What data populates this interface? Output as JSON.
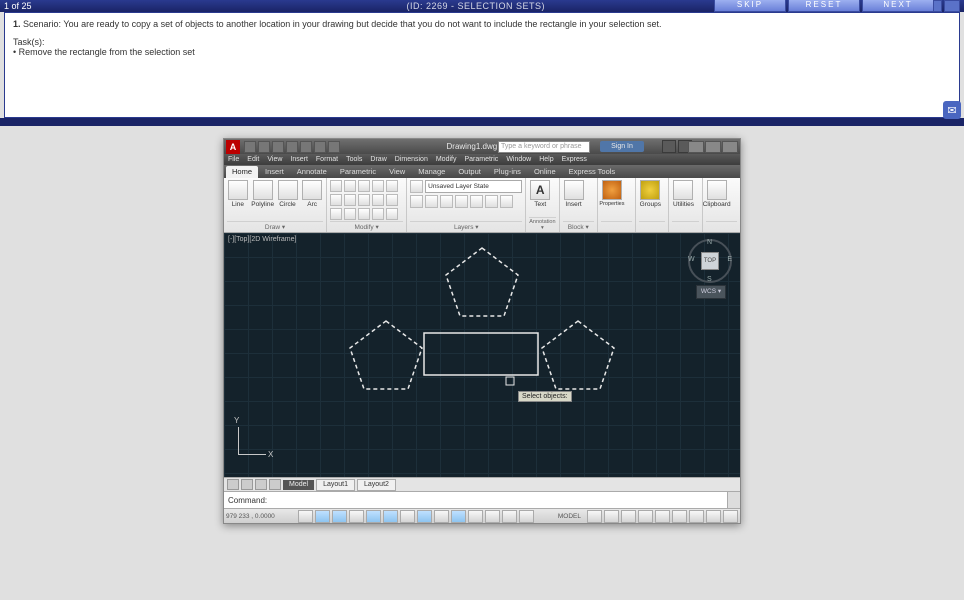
{
  "quiz": {
    "counter": "1 of 25",
    "id_label": "(ID: 2269 - SELECTION SETS)",
    "buttons": {
      "skip": "SKIP",
      "reset": "RESET",
      "next": "NEXT"
    }
  },
  "task": {
    "num": "1.",
    "scenario_label": "Scenario:",
    "scenario": "You are ready to copy a set of objects to another location in your drawing but decide that you do not want to include the rectangle in your selection set.",
    "tasks_label": "Task(s):",
    "task1": "• Remove the rectangle from the selection set"
  },
  "titlebar": {
    "logo": "A",
    "document": "Drawing1.dwg",
    "search_placeholder": "Type a keyword or phrase",
    "signin": "Sign In"
  },
  "menus": [
    "File",
    "Edit",
    "View",
    "Insert",
    "Format",
    "Tools",
    "Draw",
    "Dimension",
    "Modify",
    "Parametric",
    "Window",
    "Help",
    "Express"
  ],
  "ribbon_tabs": [
    "Home",
    "Insert",
    "Annotate",
    "Parametric",
    "View",
    "Manage",
    "Output",
    "Plug-ins",
    "Online",
    "Express Tools"
  ],
  "ribbon": {
    "draw": {
      "name": "Draw ▾",
      "items": [
        "Line",
        "Polyline",
        "Circle",
        "Arc"
      ]
    },
    "modify": {
      "name": "Modify ▾"
    },
    "layers": {
      "name": "Layers ▾",
      "state": "Unsaved Layer State"
    },
    "annotation": {
      "name": "Annotation ▾",
      "text": "Text"
    },
    "block": {
      "name": "Block ▾",
      "insert": "Insert"
    },
    "props": {
      "name": "Properties"
    },
    "groups": {
      "name": "Groups"
    },
    "utilities": {
      "name": "Utilities"
    },
    "clipboard": {
      "name": "Clipboard"
    }
  },
  "canvas": {
    "view_label": "[-][Top][2D Wireframe]",
    "viewcube": {
      "top": "TOP",
      "n": "N",
      "s": "S",
      "e": "E",
      "w": "W",
      "wcs": "WCS ▾"
    },
    "ucs": {
      "x": "X",
      "y": "Y"
    },
    "tooltip": "Select objects:"
  },
  "layout_tabs": {
    "model": "Model",
    "l1": "Layout1",
    "l2": "Layout2"
  },
  "command": {
    "label": "Command:",
    "value": ""
  },
  "status": {
    "coords": "979    233 , 0.0000",
    "model": "MODEL"
  }
}
